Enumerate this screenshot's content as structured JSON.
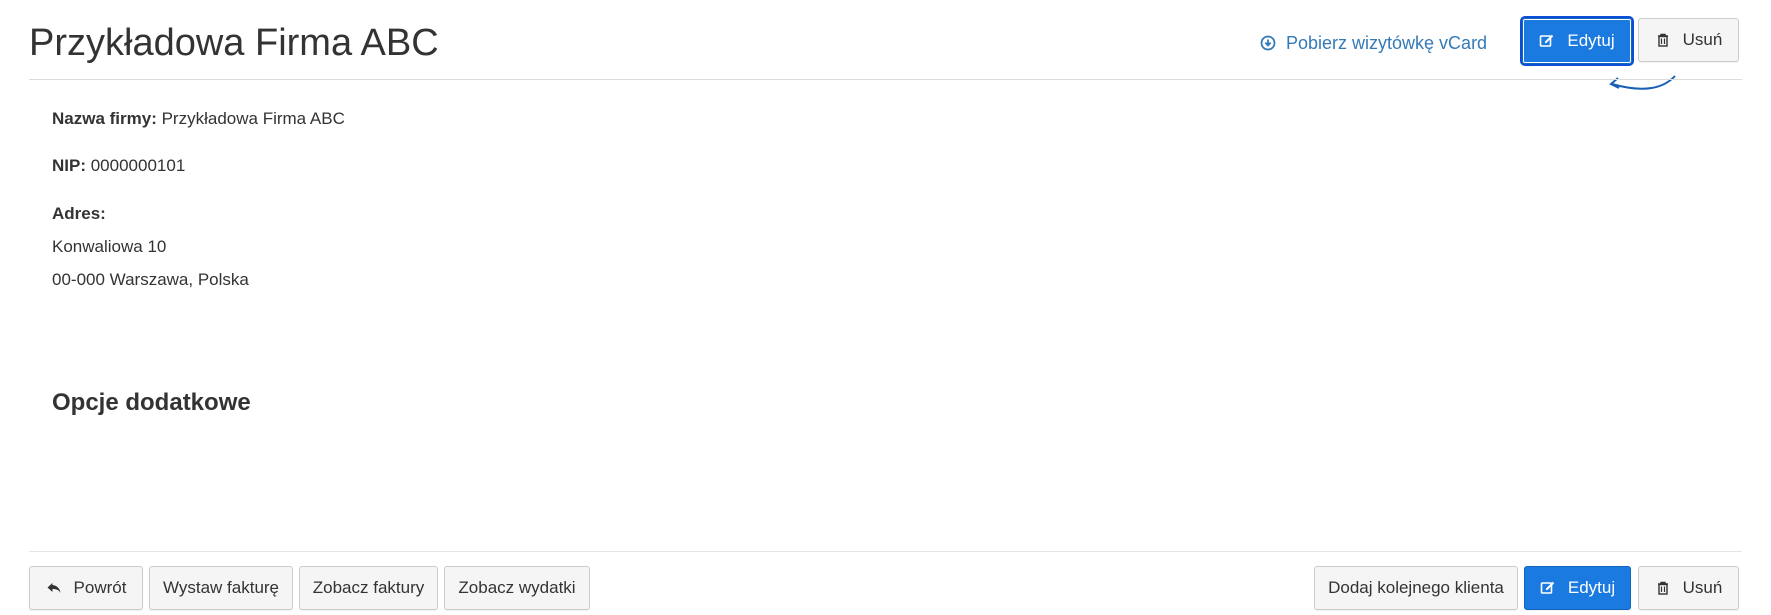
{
  "header": {
    "title": "Przykładowa Firma ABC",
    "vcard_link": "Pobierz wizytówkę vCard",
    "edit_label": "Edytuj",
    "delete_label": "Usuń"
  },
  "details": {
    "company_name_label": "Nazwa firmy:",
    "company_name_value": " Przykładowa Firma ABC",
    "nip_label": "NIP:",
    "nip_value": " 0000000101",
    "address_label": "Adres:",
    "address_line1": "Konwaliowa 10",
    "address_line2": "00-000 Warszawa, Polska"
  },
  "additional_section": {
    "heading": "Opcje dodatkowe"
  },
  "footer": {
    "back_label": "Powrót",
    "issue_invoice_label": "Wystaw fakturę",
    "view_invoices_label": "Zobacz faktury",
    "view_expenses_label": "Zobacz wydatki",
    "add_client_label": "Dodaj kolejnego klienta",
    "edit_label": "Edytuj",
    "delete_label": "Usuń"
  },
  "colors": {
    "primary": "#1a7ae0",
    "link": "#337ab7",
    "focus_outline": "#0b4fd6"
  }
}
